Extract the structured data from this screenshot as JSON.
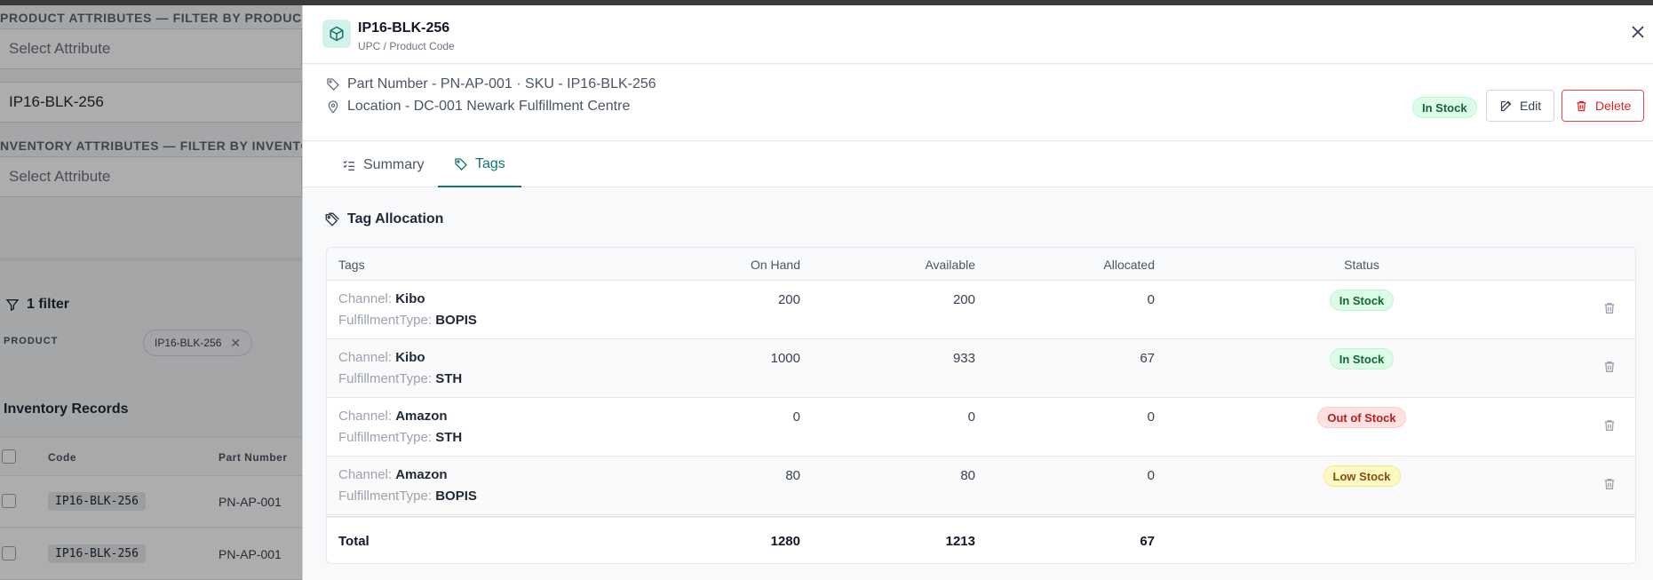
{
  "background": {
    "product_attributes_label": "PRODUCT ATTRIBUTES — FILTER BY PRODUCT PRO",
    "product_select_placeholder": "Select Attribute",
    "product_value": "IP16-BLK-256",
    "inventory_attributes_label": "NVENTORY ATTRIBUTES — FILTER BY INVENTORY",
    "inventory_select_placeholder": "Select Attribute",
    "filter_count": "1 filter",
    "product_label": "PRODUCT",
    "product_chip": "IP16-BLK-256",
    "records_title": "Inventory Records",
    "columns": {
      "code": "Code",
      "part_number": "Part Number"
    },
    "rows": [
      {
        "code": "IP16-BLK-256",
        "part_number": "PN-AP-001"
      },
      {
        "code": "IP16-BLK-256",
        "part_number": "PN-AP-001"
      }
    ]
  },
  "drawer": {
    "title": "IP16-BLK-256",
    "subtitle": "UPC / Product Code",
    "part_line": "Part Number - PN-AP-001 · SKU - IP16-BLK-256",
    "location_line": "Location - DC-001 Newark Fulfillment Centre",
    "status_badge": "In Stock",
    "edit_label": "Edit",
    "delete_label": "Delete",
    "tabs": [
      {
        "label": "Summary",
        "active": false
      },
      {
        "label": "Tags",
        "active": true
      }
    ],
    "section_title": "Tag Allocation",
    "table": {
      "headers": {
        "tags": "Tags",
        "on_hand": "On Hand",
        "available": "Available",
        "allocated": "Allocated",
        "status": "Status"
      },
      "rows": [
        {
          "k1": "Channel:",
          "v1": "Kibo",
          "k2": "FulfillmentType:",
          "v2": "BOPIS",
          "on_hand": "200",
          "available": "200",
          "allocated": "0",
          "status": "In Stock",
          "status_type": "green"
        },
        {
          "k1": "Channel:",
          "v1": "Kibo",
          "k2": "FulfillmentType:",
          "v2": "STH",
          "on_hand": "1000",
          "available": "933",
          "allocated": "67",
          "status": "In Stock",
          "status_type": "green"
        },
        {
          "k1": "Channel:",
          "v1": "Amazon",
          "k2": "FulfillmentType:",
          "v2": "STH",
          "on_hand": "0",
          "available": "0",
          "allocated": "0",
          "status": "Out of Stock",
          "status_type": "red"
        },
        {
          "k1": "Channel:",
          "v1": "Amazon",
          "k2": "FulfillmentType:",
          "v2": "BOPIS",
          "on_hand": "80",
          "available": "80",
          "allocated": "0",
          "status": "Low Stock",
          "status_type": "yellow"
        }
      ],
      "total": {
        "label": "Total",
        "on_hand": "1280",
        "available": "1213",
        "allocated": "67"
      }
    }
  },
  "colors": {
    "accent": "#0f766e",
    "danger": "#dc2626",
    "success_bg": "#dcfce7",
    "warning_bg": "#fef9c3"
  }
}
